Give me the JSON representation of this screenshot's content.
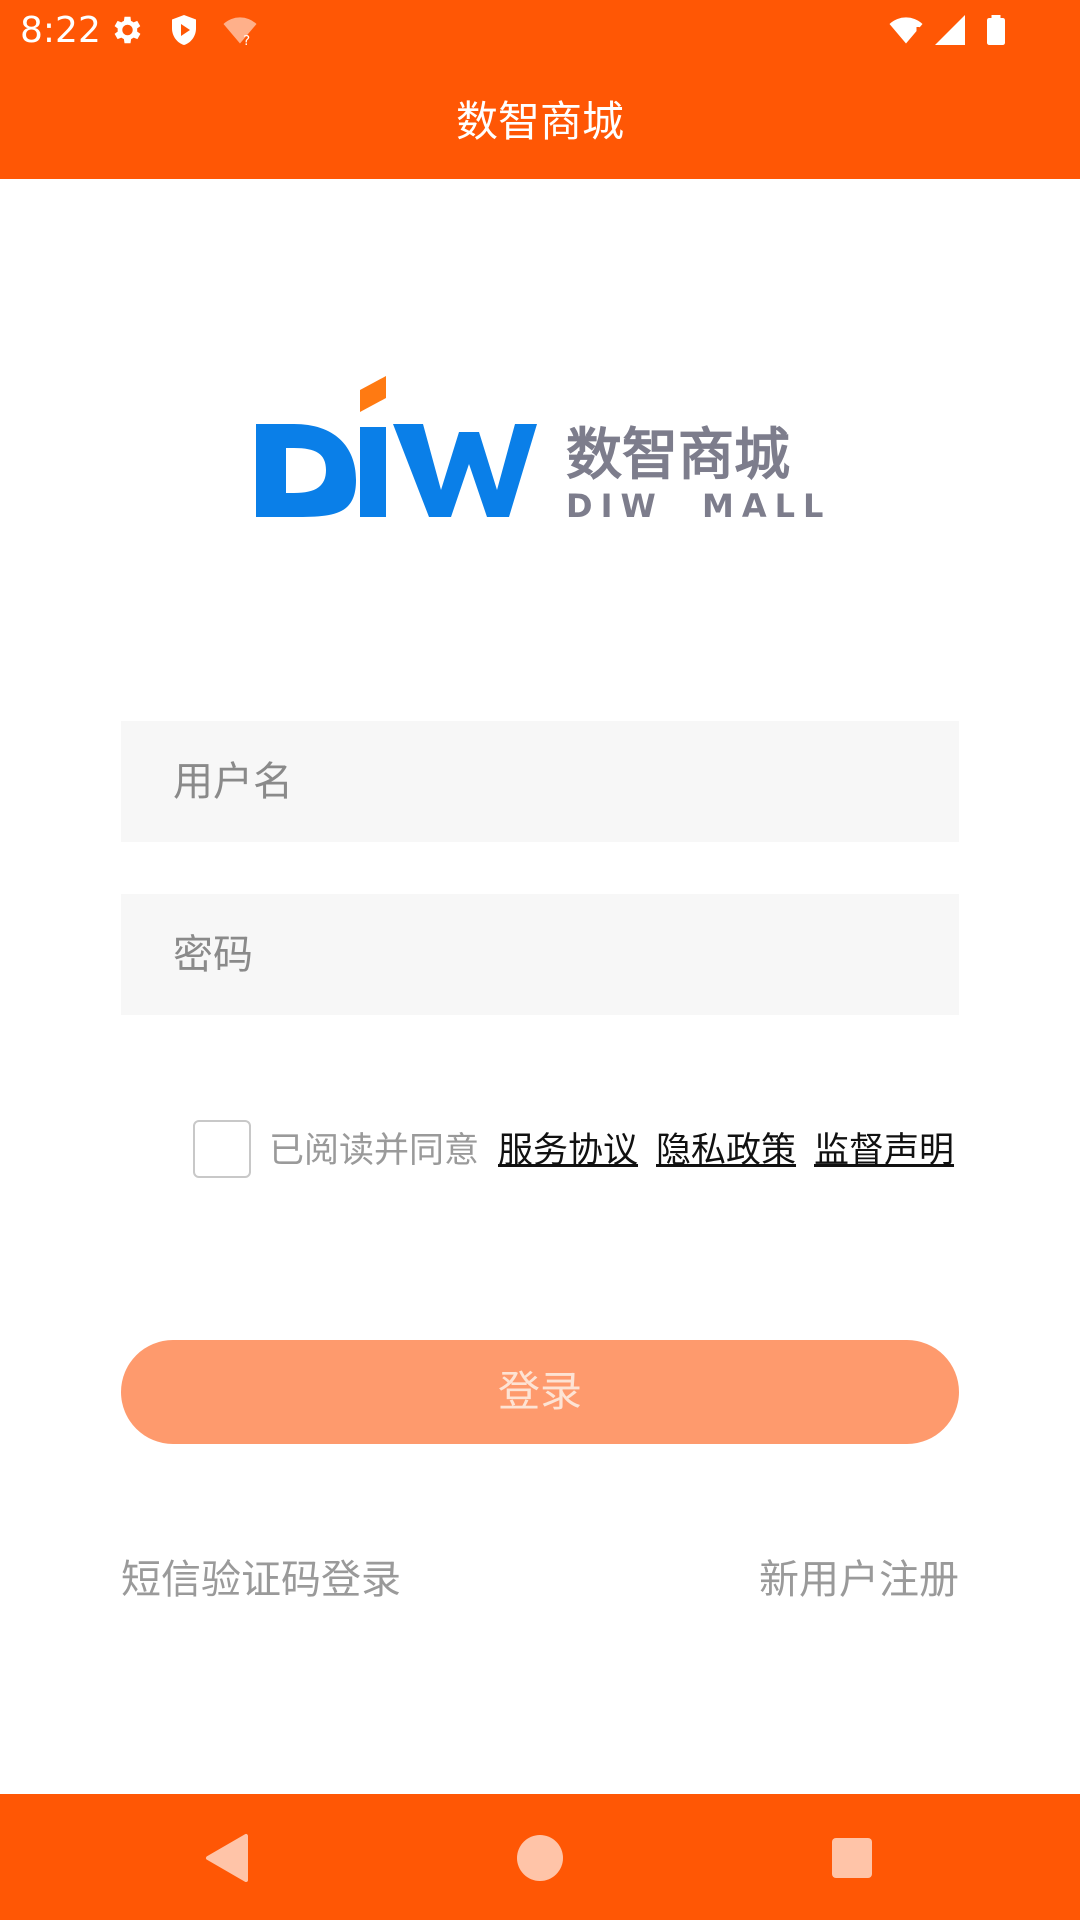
{
  "status_bar": {
    "time": "8:22",
    "icons": [
      "gear-icon",
      "shield-play-icon",
      "wifi-question-icon",
      "wifi-icon",
      "signal-icon",
      "battery-icon"
    ]
  },
  "app_bar": {
    "title": "数智商城"
  },
  "logo": {
    "brand": "DIW",
    "cn_name": "数智商城",
    "en_name": "DIW  MALL"
  },
  "form": {
    "username_placeholder": "用户名",
    "password_placeholder": "密码"
  },
  "agreement": {
    "checked": false,
    "prefix": "已阅读并同意",
    "links": [
      "服务协议",
      "隐私政策",
      "监督声明"
    ]
  },
  "login_button": {
    "label": "登录"
  },
  "bottom_links": {
    "sms_login": "短信验证码登录",
    "register": "新用户注册"
  },
  "colors": {
    "brand_orange": "#ff5705",
    "button_disabled": "#fe9a6d",
    "logo_blue": "#0a7fe8",
    "logo_gray": "#7d7d8c"
  }
}
